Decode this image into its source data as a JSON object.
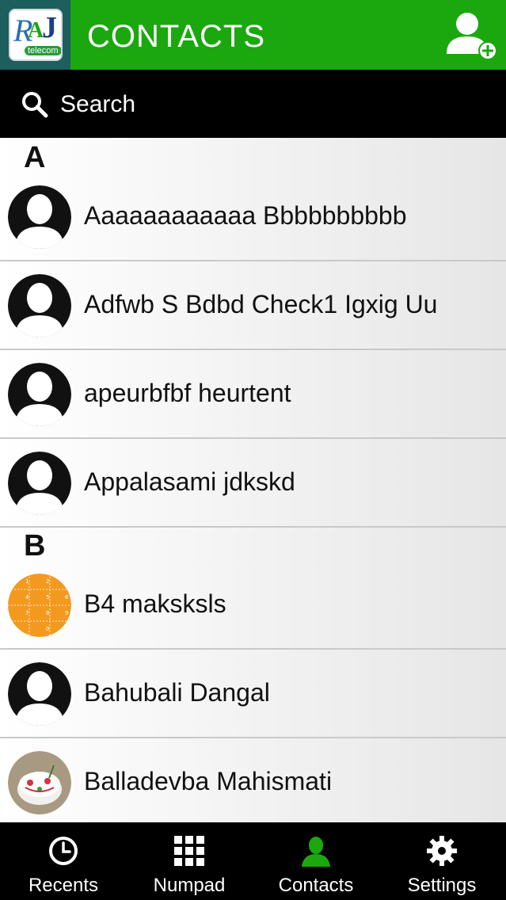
{
  "header": {
    "title": "CONTACTS",
    "logo_text": "RAJ",
    "logo_subtext": "telecom",
    "add_contact_icon": "add-user-icon",
    "accent_color": "#1aa80e"
  },
  "search": {
    "placeholder": "Search",
    "icon": "search-icon"
  },
  "contacts": {
    "sections": [
      {
        "letter": "A",
        "items": [
          {
            "name": "Aaaaaaaaaaaa Bbbbbbbbbb",
            "avatar": "default-person"
          },
          {
            "name": "Adfwb S Bdbd Check1 Igxig Uu",
            "avatar": "default-person"
          },
          {
            "name": "apeurbfbf heurtent",
            "avatar": "default-person"
          },
          {
            "name": "Appalasami jdkskd",
            "avatar": "default-person"
          }
        ]
      },
      {
        "letter": "B",
        "items": [
          {
            "name": "B4 maksksls",
            "avatar": "orange-keypad-photo"
          },
          {
            "name": "Bahubali Dangal",
            "avatar": "default-person"
          },
          {
            "name": "Balladevba Mahismati",
            "avatar": "cake-photo"
          }
        ]
      }
    ]
  },
  "nav": {
    "tabs": [
      {
        "label": "Recents",
        "icon": "clock-icon",
        "active": false
      },
      {
        "label": "Numpad",
        "icon": "grid-icon",
        "active": false
      },
      {
        "label": "Contacts",
        "icon": "person-icon",
        "active": true
      },
      {
        "label": "Settings",
        "icon": "gear-icon",
        "active": false
      }
    ],
    "active_color": "#1aa80e"
  }
}
